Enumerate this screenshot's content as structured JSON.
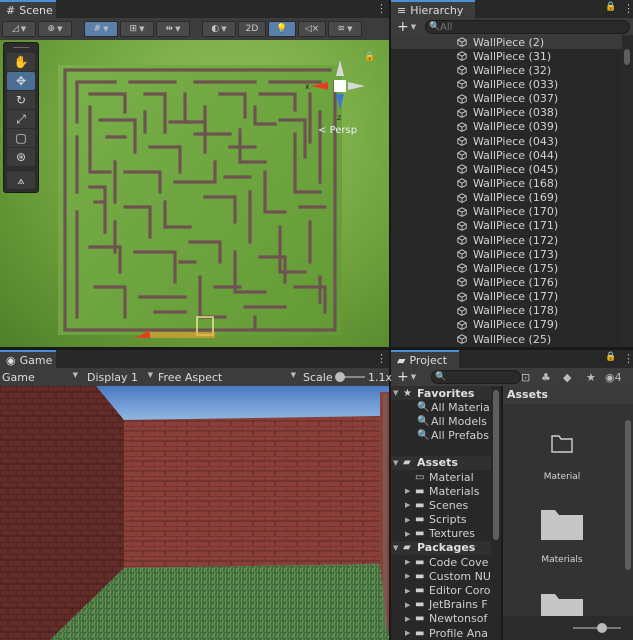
{
  "scene": {
    "tab_label": "Scene",
    "btn_2d": "2D",
    "persp_label": "Persp",
    "gizmo_x": "x",
    "gizmo_z": "z"
  },
  "hierarchy": {
    "tab_label": "Hierarchy",
    "add_label": "+",
    "search_placeholder": "All",
    "items": [
      "WallPiece (2)",
      "WallPiece (31)",
      "WallPiece (32)",
      "WallPiece (033)",
      "WallPiece (037)",
      "WallPiece (038)",
      "WallPiece (039)",
      "WallPiece (043)",
      "WallPiece (044)",
      "WallPiece (045)",
      "WallPiece (168)",
      "WallPiece (169)",
      "WallPiece (170)",
      "WallPiece (171)",
      "WallPiece (172)",
      "WallPiece (173)",
      "WallPiece (175)",
      "WallPiece (176)",
      "WallPiece (177)",
      "WallPiece (178)",
      "WallPiece (179)",
      "WallPiece (25)"
    ]
  },
  "game": {
    "tab_label": "Game",
    "mode": "Game",
    "display": "Display 1",
    "aspect": "Free Aspect",
    "scale_label": "Scale",
    "scale_value": "1.1x"
  },
  "project": {
    "tab_label": "Project",
    "badge_count": "4",
    "add_label": "+",
    "tree": {
      "favorites_label": "Favorites",
      "favorites": [
        "All Materia",
        "All Models",
        "All Prefabs"
      ],
      "assets_label": "Assets",
      "assets": [
        "Material",
        "Materials",
        "Scenes",
        "Scripts",
        "Textures"
      ],
      "packages_label": "Packages",
      "packages": [
        "Code Cove",
        "Custom NU",
        "Editor Coro",
        "JetBrains F",
        "Newtonsof",
        "Profile Ana"
      ]
    },
    "assets_header": "Assets",
    "asset_items": [
      "Material",
      "Materials"
    ]
  }
}
